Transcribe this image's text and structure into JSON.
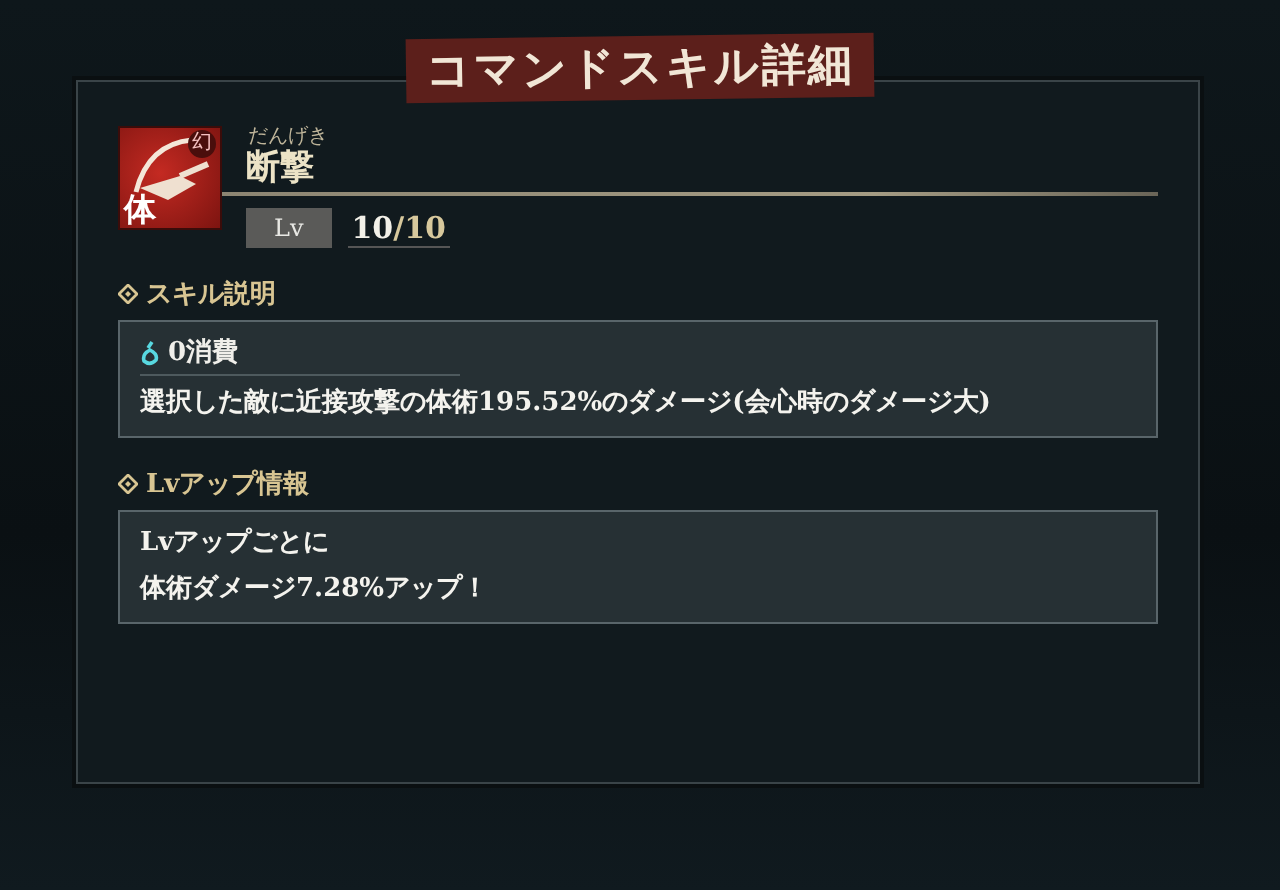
{
  "title": "コマンドスキル詳細",
  "skill": {
    "icon_badge": "幻",
    "icon_type": "体",
    "reading": "だんげき",
    "name": "断撃",
    "level_label": "Lv",
    "level_value": "10",
    "level_max": "/10"
  },
  "sections": [
    {
      "heading": "スキル説明",
      "cost": "0消費",
      "lines": [
        "選択した敵に近接攻撃の体術195.52%のダメージ(会心時のダメージ大)"
      ]
    },
    {
      "heading": "Lvアップ情報",
      "lines": [
        "Lvアップごとに",
        "体術ダメージ7.28%アップ！"
      ]
    }
  ]
}
